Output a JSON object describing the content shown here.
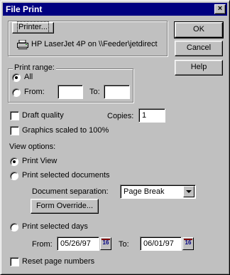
{
  "window": {
    "title": "File Print",
    "close_glyph": "×"
  },
  "buttons": {
    "ok": "OK",
    "cancel": "Cancel",
    "help": "Help",
    "printer": "Printer...",
    "form_override": "Form Override..."
  },
  "printer": {
    "name": "HP LaserJet 4P on \\\\Feeder\\jetdirect",
    "icon": "printer-icon"
  },
  "print_range": {
    "legend": "Print range:",
    "all_label": "All",
    "all_selected": true,
    "from_label": "From:",
    "to_label": "To:",
    "from_value": "",
    "to_value": ""
  },
  "options": {
    "draft_quality": "Draft quality",
    "draft_checked": false,
    "graphics_scaled": "Graphics scaled to 100%",
    "graphics_checked": false,
    "copies_label": "Copies:",
    "copies_value": "1"
  },
  "view_options": {
    "label": "View options:",
    "print_view": "Print View",
    "print_view_selected": true,
    "print_selected_documents": "Print selected documents",
    "document_separation_label": "Document separation:",
    "document_separation_value": "Page Break"
  },
  "days": {
    "label": "Print selected days",
    "from_label": "From:",
    "from_value": "05/26/97",
    "to_label": "To:",
    "to_value": "06/01/97",
    "calendar_glyph": "16"
  },
  "reset_page_numbers": {
    "label": "Reset page numbers",
    "checked": false
  }
}
